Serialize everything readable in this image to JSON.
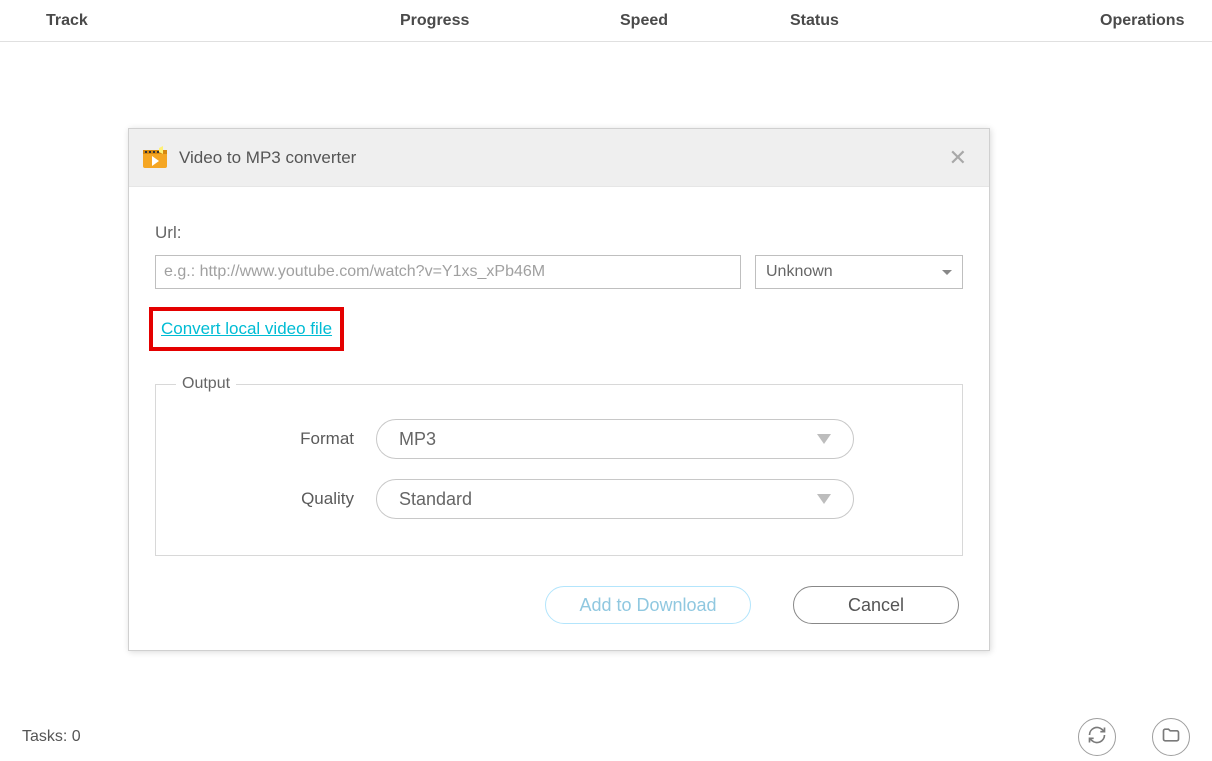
{
  "table": {
    "headers": {
      "track": "Track",
      "progress": "Progress",
      "speed": "Speed",
      "status": "Status",
      "operations": "Operations"
    }
  },
  "modal": {
    "title": "Video to MP3 converter",
    "url_label": "Url:",
    "url_placeholder": "e.g.: http://www.youtube.com/watch?v=Y1xs_xPb46M",
    "source_select": "Unknown",
    "convert_link": "Convert local video file",
    "output_legend": "Output",
    "format_label": "Format",
    "format_value": "MP3",
    "quality_label": "Quality",
    "quality_value": "Standard",
    "add_button": "Add to Download",
    "cancel_button": "Cancel"
  },
  "statusbar": {
    "tasks": "Tasks: 0"
  }
}
